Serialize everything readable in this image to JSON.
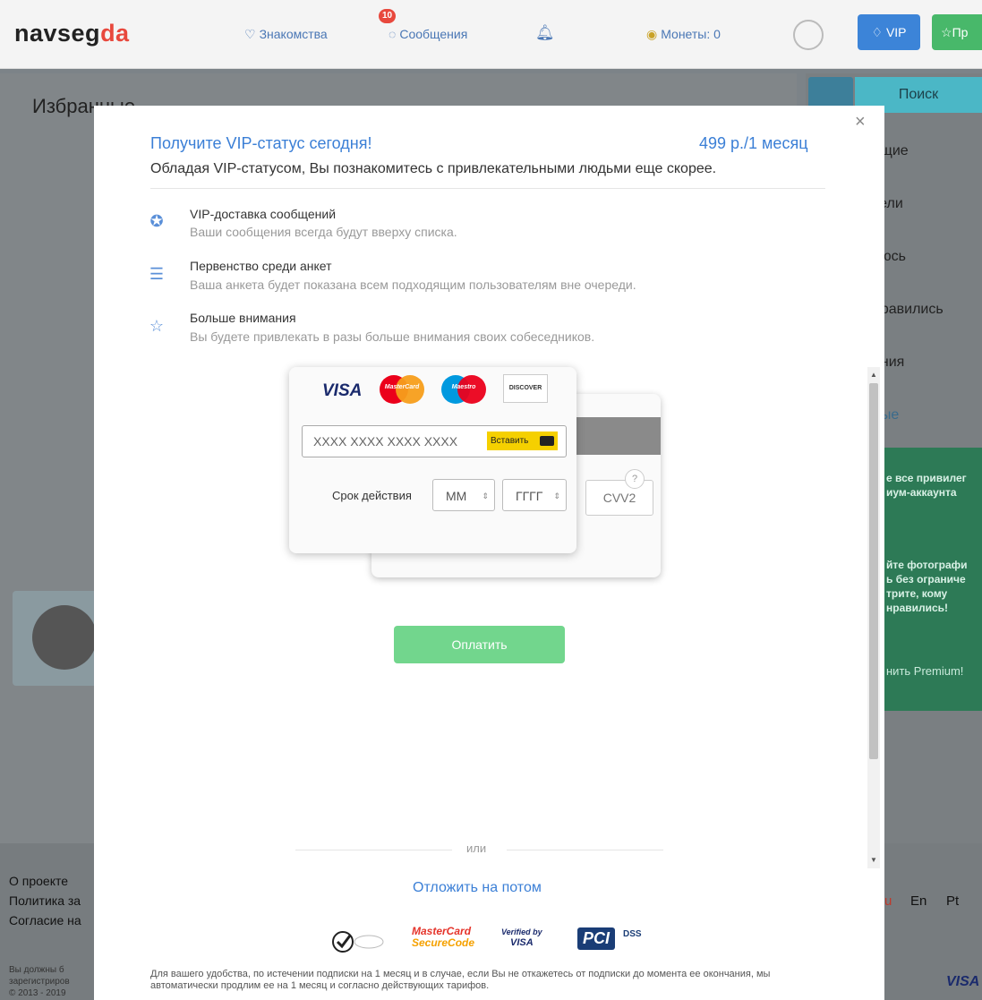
{
  "topbar": {
    "logo_main": "navseg",
    "logo_accent": "da",
    "nav": {
      "dating": "Знакомства",
      "messages": "Сообщения",
      "messages_badge": "10",
      "coins": "Монеты: 0"
    },
    "vip_label": "VIP",
    "premium_label": "Пр"
  },
  "page": {
    "heading": "Избранные"
  },
  "sidebar": {
    "search": "Поиск",
    "items": [
      "ящие",
      "тели",
      "пюсь",
      "нравились",
      "ения",
      "ные"
    ],
    "active_index": 5,
    "promo_lines_1": [
      "е все привилег",
      "иум-аккаунта"
    ],
    "promo_lines_2": [
      "йте фотографи",
      "ь без ограниче",
      "трите, кому",
      "нравились!"
    ],
    "promo_button": "нить Premium!"
  },
  "footer": {
    "links": [
      "О проекте",
      "Политика за",
      "Согласие на"
    ],
    "languages": [
      "u",
      "En",
      "Pt"
    ],
    "small_lines": [
      "Вы должны б",
      "зарегистриров",
      "© 2013 - 2019"
    ],
    "visa": "VISA"
  },
  "modal": {
    "title": "Получите VIP-статус сегодня!",
    "price": "499 р./1 месяц",
    "subtitle": "Обладая VIP-статусом, Вы познакомитесь с привлекательными людьми еще скорее.",
    "features": [
      {
        "icon": "message-star-icon",
        "title": "VIP-доставка сообщений",
        "desc": "Ваши сообщения всегда будут вверху списка."
      },
      {
        "icon": "profile-star-icon",
        "title": "Первенство среди анкет",
        "desc": "Ваша анкета будет показана всем подходящим пользователям вне очереди."
      },
      {
        "icon": "stars-icon",
        "title": "Больше внимания",
        "desc": "Вы будете привлекать в разы больше внимания своих собеседников."
      }
    ],
    "card": {
      "brands": [
        "VISA",
        "MasterCard",
        "Maestro",
        "DISCOVER"
      ],
      "number_placeholder": "XXXX XXXX XXXX XXXX",
      "paste_label": "Вставить",
      "expiry_label": "Срок действия",
      "month_placeholder": "MM",
      "year_placeholder": "ГГГГ",
      "cvv_placeholder": "CVV2",
      "help": "?"
    },
    "pay_button": "Оплатить",
    "or": "или",
    "later": "Отложить на потом",
    "badges": {
      "mc_line1": "MasterCard",
      "mc_line2": "SecureCode",
      "vbv_line1": "Verified by",
      "vbv_line2": "VISA",
      "pci": "PCI",
      "dss": "DSS"
    },
    "disclaimer": "Для вашего удобства, по истечении подписки на 1 месяц и в случае, если Вы не откажетесь от подписки до момента ее окончания, мы автоматически продлим ее на 1 месяц и согласно действующих тарифов."
  },
  "colors": {
    "accent_blue": "#3b7fd6",
    "pay_green": "#72d68d",
    "logo_red": "#e8483d",
    "paste_yellow": "#f5d000"
  }
}
